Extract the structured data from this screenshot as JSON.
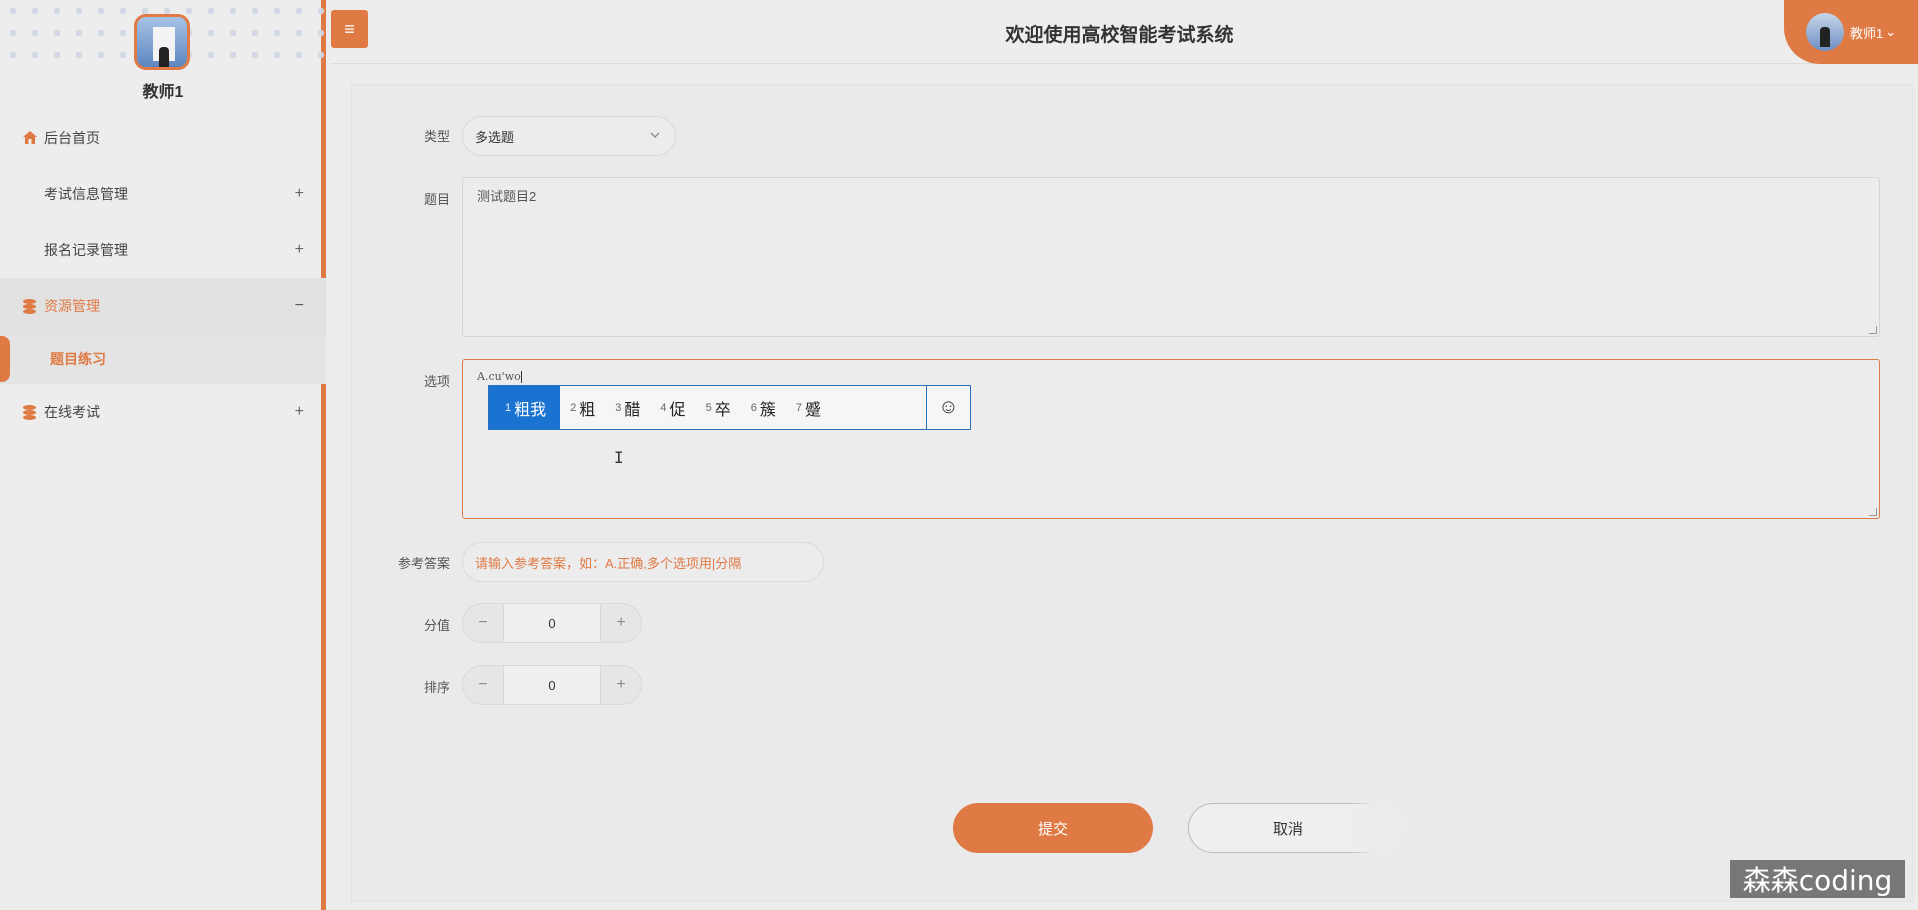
{
  "sidebar": {
    "username": "教师1",
    "menu": [
      {
        "label": "后台首页",
        "icon": "home-icon"
      },
      {
        "label": "考试信息管理",
        "icon": "grid-icon",
        "toggle": "+"
      },
      {
        "label": "报名记录管理",
        "icon": "grid-icon",
        "toggle": "+"
      },
      {
        "label": "资源管理",
        "icon": "database-icon",
        "toggle": "−",
        "active": true
      },
      {
        "label": "在线考试",
        "icon": "database-icon",
        "toggle": "+"
      }
    ],
    "submenu": {
      "label": "题目练习"
    }
  },
  "header": {
    "menu_icon": "≡",
    "title": "欢迎使用高校智能考试系统",
    "user_label": "教师1",
    "user_caret": "⌄"
  },
  "form": {
    "type": {
      "label": "类型",
      "value": "多选题"
    },
    "question": {
      "label": "题目",
      "value": "测试题目2"
    },
    "options": {
      "label": "选项",
      "value": "A.cu'wo"
    },
    "ime": {
      "candidates": [
        {
          "num": "1",
          "text": "粗我"
        },
        {
          "num": "2",
          "text": "粗"
        },
        {
          "num": "3",
          "text": "醋"
        },
        {
          "num": "4",
          "text": "促"
        },
        {
          "num": "5",
          "text": "卒"
        },
        {
          "num": "6",
          "text": "簇"
        },
        {
          "num": "7",
          "text": "蹙"
        }
      ],
      "emoji": "☺"
    },
    "answer": {
      "label": "参考答案",
      "placeholder": "请输入参考答案，如：A.正确,多个选项用|分隔"
    },
    "score": {
      "label": "分值",
      "value": "0"
    },
    "sort": {
      "label": "排序",
      "value": "0"
    },
    "stepper_minus": "−",
    "stepper_plus": "+",
    "submit_label": "提交",
    "cancel_label": "取消"
  },
  "watermark": "森森coding",
  "colors": {
    "accent": "#e07a45",
    "ime_selected": "#1a73d0"
  }
}
